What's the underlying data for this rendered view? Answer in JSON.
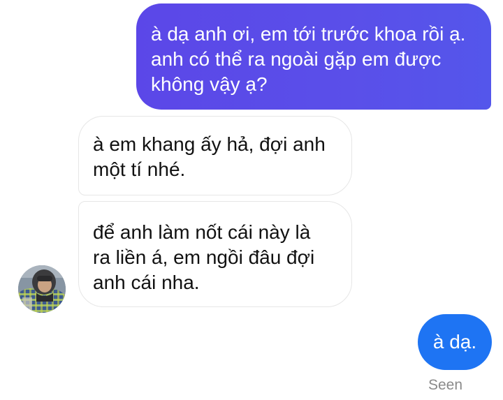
{
  "conversation": {
    "messages": [
      {
        "direction": "outgoing",
        "text": "à dạ anh ơi, em tới trước khoa rồi ạ.\nanh có thể ra ngoài gặp em được\nkhông vậy ạ?"
      },
      {
        "direction": "incoming",
        "text": "à em khang ấy hả, đợi anh\nmột tí nhé."
      },
      {
        "direction": "incoming",
        "text": "để anh làm nốt cái này là\nra liền á, em ngồi đâu đợi\nanh cái nha."
      },
      {
        "direction": "outgoing",
        "text": "à dạ."
      }
    ],
    "seen_label": "Seen"
  },
  "contact": {
    "avatar_icon": "person-avatar"
  },
  "colors": {
    "outgoing_gradient_start": "#5b47e8",
    "outgoing_gradient_end": "#5456eb",
    "outgoing_blue": "#1e74f3",
    "incoming_border": "#e6e6e6",
    "seen_text": "#8a8a8a"
  }
}
